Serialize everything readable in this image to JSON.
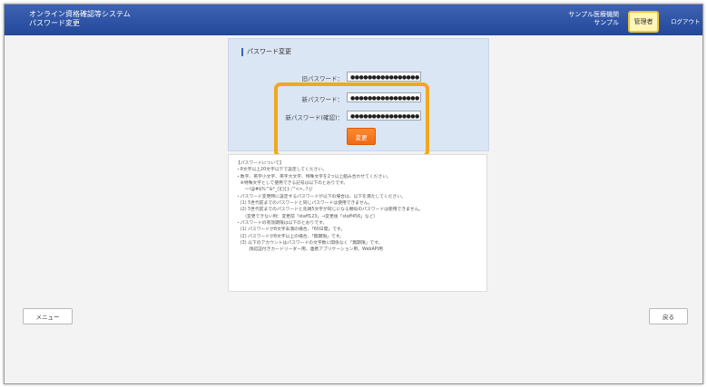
{
  "header": {
    "app_name": "オンライン資格確認等システム",
    "page_name": "パスワード変更",
    "org_name": "サンプル医療機関",
    "user_name": "サンプル",
    "role": "管理者",
    "logout": "ログアウト"
  },
  "form": {
    "title": "パスワード変更",
    "old_label": "旧パスワード：",
    "old_value": "●●●●●●●●●●●●●●●●",
    "new_label": "新パスワード：",
    "new_value": "●●●●●●●●●●●●●●●●",
    "confirm_label": "新パスワード(確認)：",
    "confirm_value": "●●●●●●●●●●●●●●●●",
    "submit": "変更"
  },
  "info": [
    "【パスワードについて】",
    "・8文字以上20文字以下で設定してください。",
    "・数字、英字小文字、英字大文字、特殊文字を2つ以上組み合わせてください。",
    "　※特殊文字として使用できる記号は以下のとおりです。",
    "　　～!@#$%^&*_()[]{}:;'\"<>,.?-|/",
    "・パスワード変更時に設定するパスワードが以下の場合は、以下を満たしてください。",
    "　(1) 5世代前までのパスワードと同じパスワードは使用できません。",
    "　(2) 5世代前までのパスワードと先頭5文字が同じになる類似のパスワードは使用できません。",
    "　　（変更できない例：変更前「staff123」→変更後「staff456」など）",
    "・パスワードの有効期限は以下のとおりです。",
    "　(1) パスワードが8文字未満の場合、「60日間」です。",
    "　(2) パスワードが8文字以上の場合、「無期限」です。",
    "　(3) 以下のアカウントはパスワードの文字数に関係なく「無期限」です。",
    "　　　顔認証付きカードリーダー用、連携アプリケーション用、WebAPI用"
  ],
  "footer": {
    "menu": "メニュー",
    "back": "戻る"
  },
  "colors": {
    "header": "#2d52a5",
    "accent": "#f27a1f",
    "highlight": "#f0a81c",
    "badge_bg": "#fff6b8"
  }
}
